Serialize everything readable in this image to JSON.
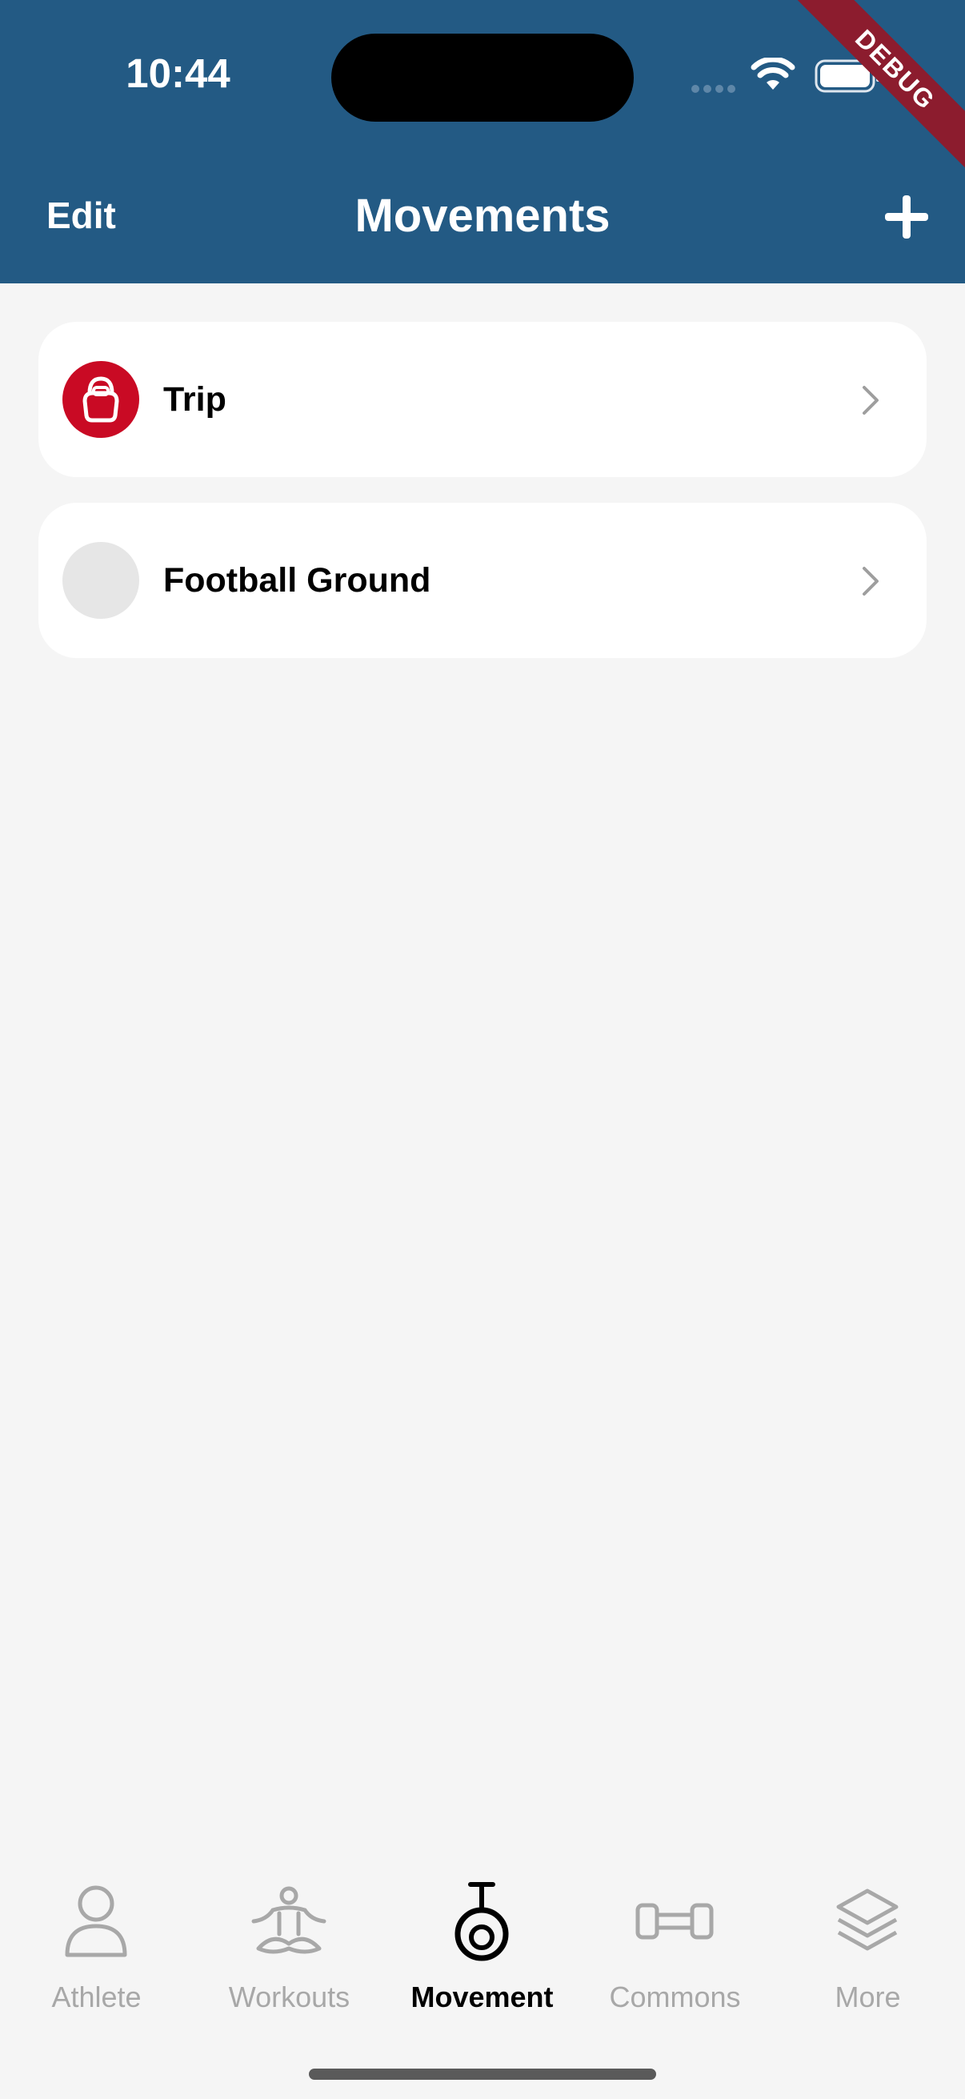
{
  "status_bar": {
    "time": "10:44"
  },
  "debug_banner": "DEBUG",
  "nav": {
    "edit_label": "Edit",
    "title": "Movements",
    "add_icon": "plus-icon"
  },
  "movements": [
    {
      "name": "Trip",
      "icon": "kettlebell-icon",
      "icon_bg": "#c90a24"
    },
    {
      "name": "Football Ground",
      "icon": "",
      "icon_bg": "#e6e6e6"
    }
  ],
  "tabs": [
    {
      "label": "Athlete",
      "icon": "person-icon",
      "active": false
    },
    {
      "label": "Workouts",
      "icon": "meditation-icon",
      "active": false
    },
    {
      "label": "Movement",
      "icon": "gymnastic-ring-icon",
      "active": true
    },
    {
      "label": "Commons",
      "icon": "dumbbell-icon",
      "active": false
    },
    {
      "label": "More",
      "icon": "layers-icon",
      "active": false
    }
  ],
  "colors": {
    "header": "#235a84",
    "accent_red": "#c90a24",
    "background": "#f5f5f5"
  }
}
